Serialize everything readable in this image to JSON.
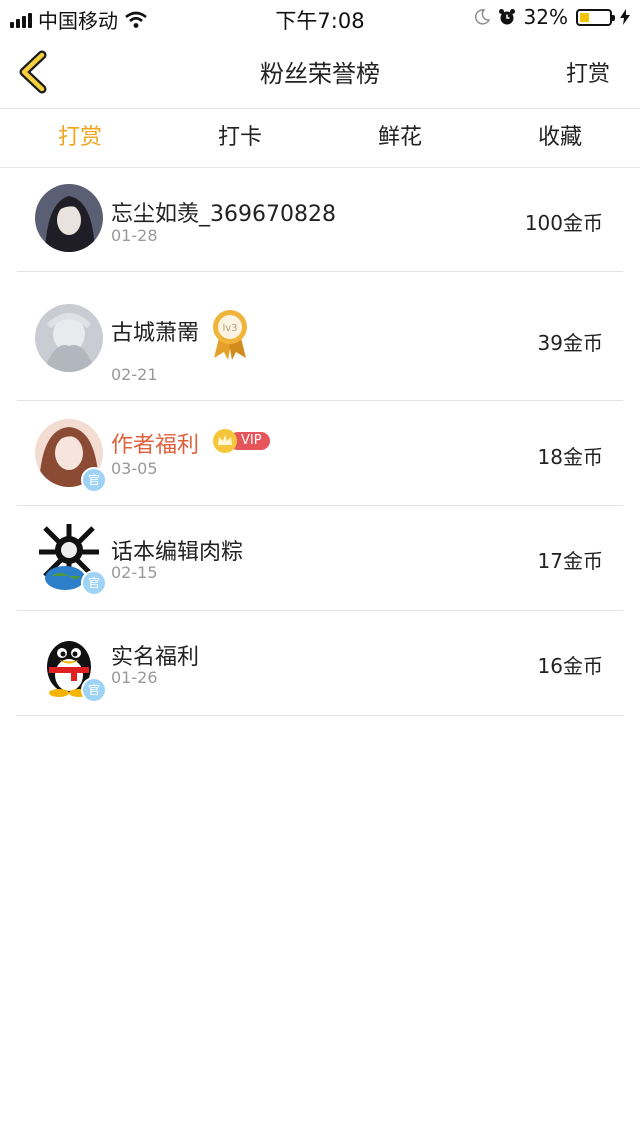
{
  "status_bar": {
    "carrier": "中国移动",
    "time": "下午7:08",
    "battery_percent": "32%",
    "battery_level": 0.32
  },
  "nav": {
    "title": "粉丝荣誉榜",
    "action": "打赏",
    "back_icon": "chevron-left-icon"
  },
  "tabs": [
    {
      "label": "打赏",
      "active": true
    },
    {
      "label": "打卡",
      "active": false
    },
    {
      "label": "鲜花",
      "active": false
    },
    {
      "label": "收藏",
      "active": false
    }
  ],
  "accent_color": "#f0a51e",
  "rows": [
    {
      "name": "忘尘如羡_369670828",
      "date": "01-28",
      "amount": "100金币"
    },
    {
      "name": "古城萧罱",
      "date": "02-21",
      "amount": "39金币",
      "badge_text": "lv3"
    },
    {
      "name": "作者福利",
      "date": "03-05",
      "amount": "18金币",
      "vip_text": "VIP"
    },
    {
      "name": "话本编辑肉粽",
      "date": "02-15",
      "amount": "17金币"
    },
    {
      "name": "实名福利",
      "date": "01-26",
      "amount": "16金币"
    }
  ]
}
